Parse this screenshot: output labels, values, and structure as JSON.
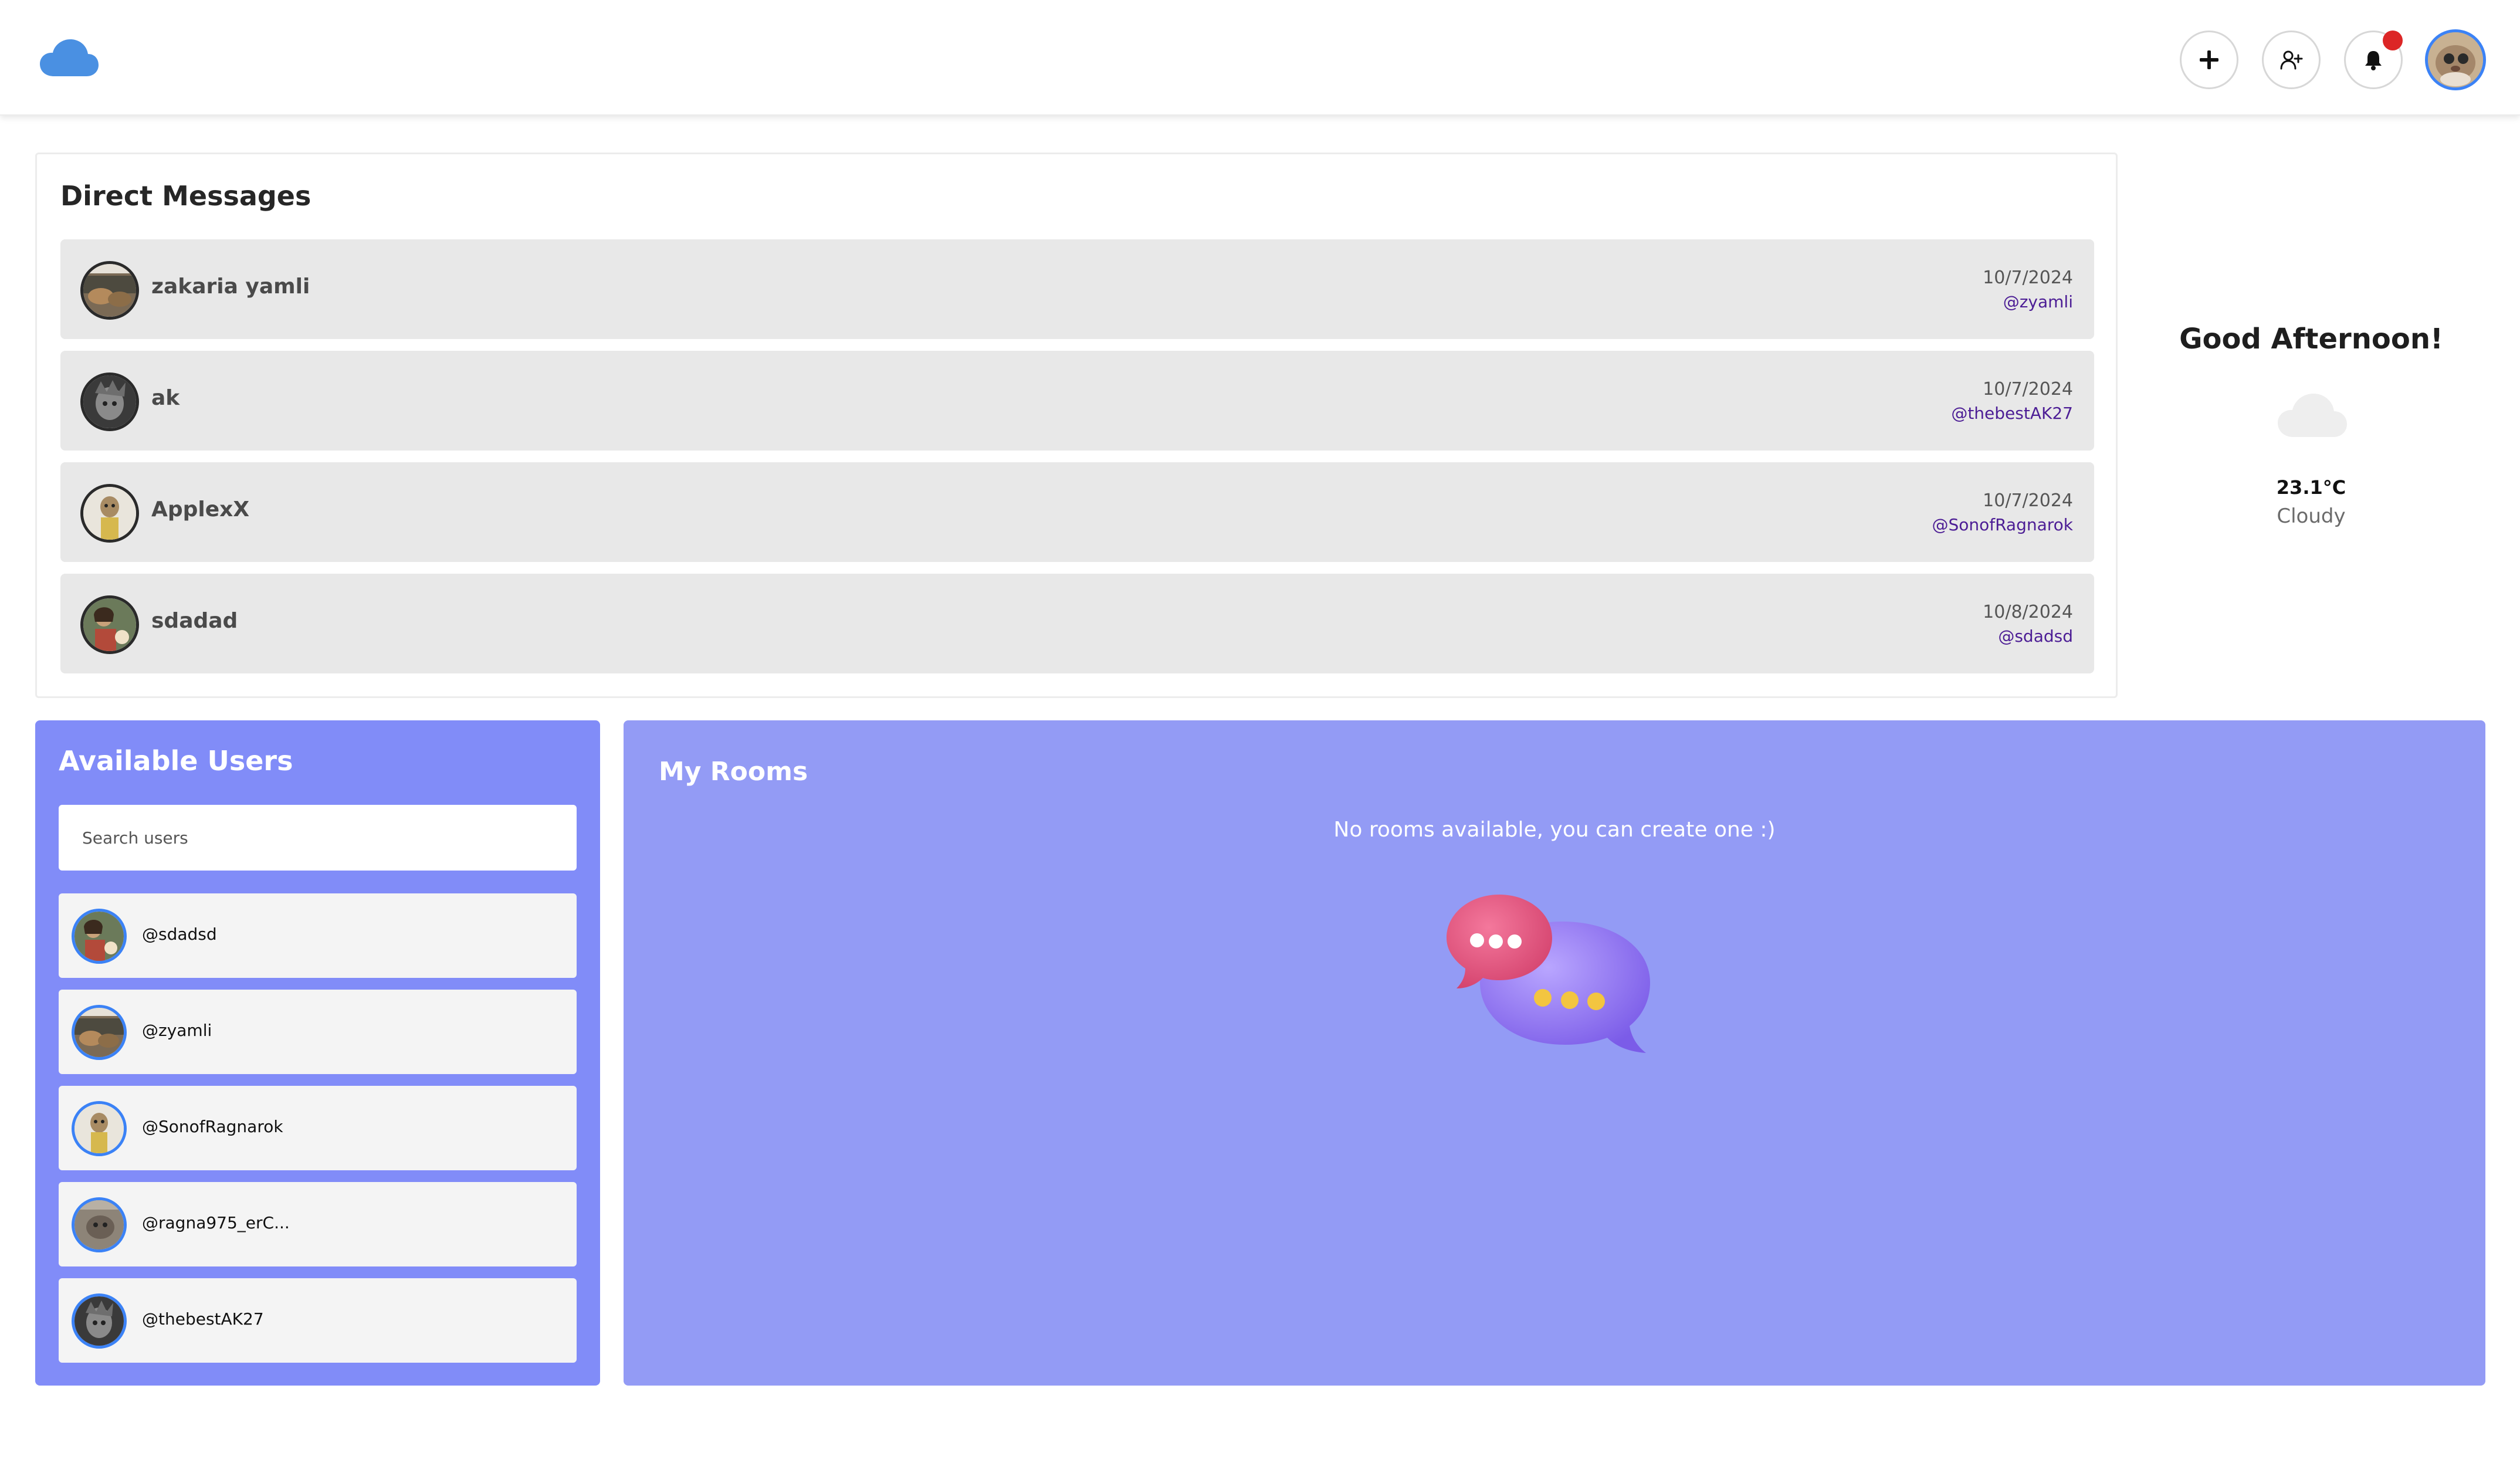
{
  "header": {
    "logo_icon": "cloud-icon",
    "accent_color": "#3b82f6",
    "buttons": [
      {
        "name": "create-button",
        "icon": "plus-icon"
      },
      {
        "name": "add-friend-button",
        "icon": "user-plus-icon"
      },
      {
        "name": "notifications-button",
        "icon": "bell-icon",
        "has_unread": true
      }
    ]
  },
  "direct_messages": {
    "title": "Direct Messages",
    "items": [
      {
        "name": "zakaria yamli",
        "date": "10/7/2024",
        "handle": "@zyamli"
      },
      {
        "name": "ak",
        "date": "10/7/2024",
        "handle": "@thebestAK27"
      },
      {
        "name": "ApplexX",
        "date": "10/7/2024",
        "handle": "@SonofRagnarok"
      },
      {
        "name": "sdadad",
        "date": "10/8/2024",
        "handle": "@sdadsd"
      }
    ]
  },
  "weather": {
    "greeting": "Good Afternoon!",
    "icon": "cloud-icon",
    "temperature": "23.1°C",
    "condition": "Cloudy"
  },
  "available_users": {
    "title": "Available Users",
    "search_placeholder": "Search users",
    "users": [
      {
        "handle": "@sdadsd"
      },
      {
        "handle": "@zyamli"
      },
      {
        "handle": "@SonofRagnarok"
      },
      {
        "handle": "@ragna975_erC..."
      },
      {
        "handle": "@thebestAK27"
      }
    ]
  },
  "rooms": {
    "title": "My Rooms",
    "empty_message": "No rooms available, you can create one :)",
    "illustration": "chat-bubbles-icon"
  },
  "colors": {
    "users_panel": "#818cf8",
    "rooms_panel": "#939bf5",
    "dm_row": "#e8e8e8",
    "handle_text": "#4c1d95",
    "notification": "#dc2626"
  }
}
